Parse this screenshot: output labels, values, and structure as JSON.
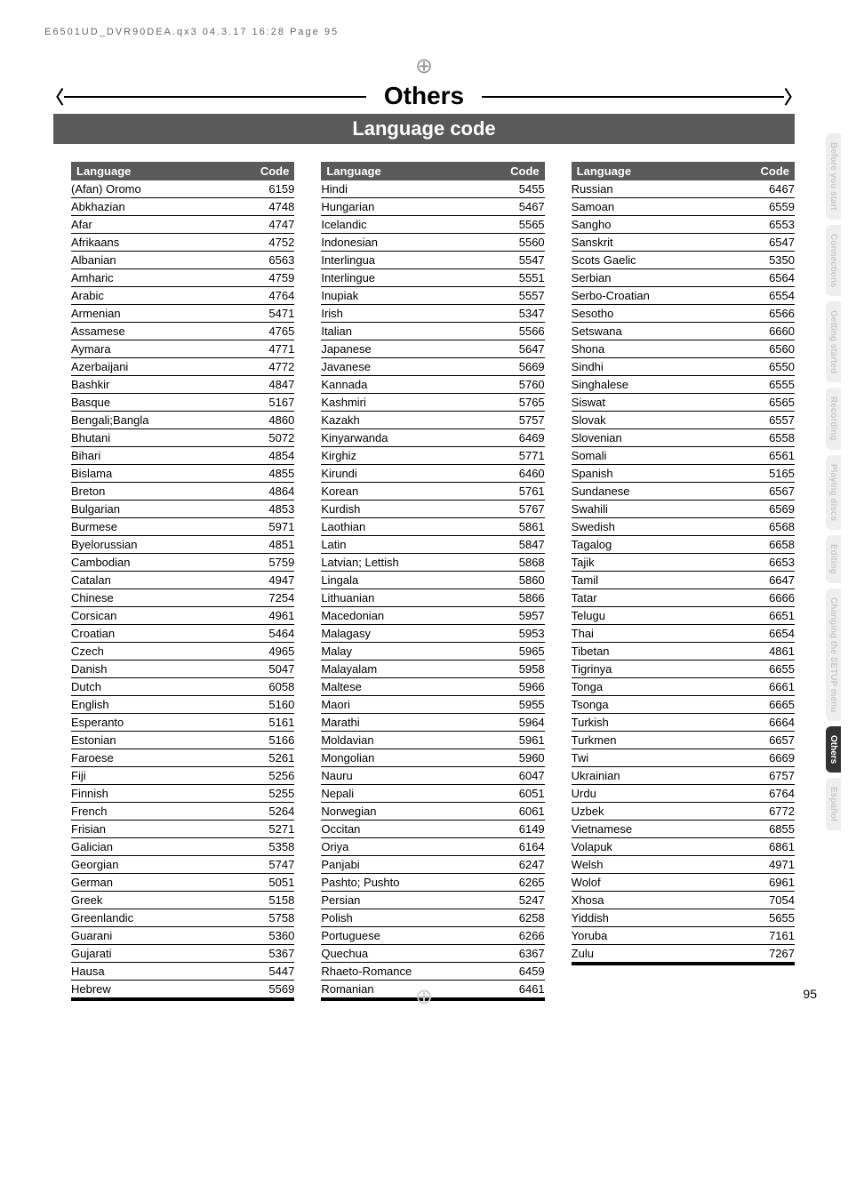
{
  "hdr": "E6501UD_DVR90DEA.qx3  04.3.17  16:28  Page 95",
  "title": "Others",
  "subtitle": "Language code",
  "th": {
    "lang": "Language",
    "code": "Code"
  },
  "tabs": [
    "Before you start",
    "Connections",
    "Getting started",
    "Recording",
    "Playing discs",
    "Editing",
    "Changing the SETUP menu",
    "Others",
    "Español"
  ],
  "tabActive": 7,
  "pageNum": "95",
  "col1": [
    [
      "(Afan) Oromo",
      "6159"
    ],
    [
      "Abkhazian",
      "4748"
    ],
    [
      "Afar",
      "4747"
    ],
    [
      "Afrikaans",
      "4752"
    ],
    [
      "Albanian",
      "6563"
    ],
    [
      "Amharic",
      "4759"
    ],
    [
      "Arabic",
      "4764"
    ],
    [
      "Armenian",
      "5471"
    ],
    [
      "Assamese",
      "4765"
    ],
    [
      "Aymara",
      "4771"
    ],
    [
      "Azerbaijani",
      "4772"
    ],
    [
      "Bashkir",
      "4847"
    ],
    [
      "Basque",
      "5167"
    ],
    [
      "Bengali;Bangla",
      "4860"
    ],
    [
      "Bhutani",
      "5072"
    ],
    [
      "Bihari",
      "4854"
    ],
    [
      "Bislama",
      "4855"
    ],
    [
      "Breton",
      "4864"
    ],
    [
      "Bulgarian",
      "4853"
    ],
    [
      "Burmese",
      "5971"
    ],
    [
      "Byelorussian",
      "4851"
    ],
    [
      "Cambodian",
      "5759"
    ],
    [
      "Catalan",
      "4947"
    ],
    [
      "Chinese",
      "7254"
    ],
    [
      "Corsican",
      "4961"
    ],
    [
      "Croatian",
      "5464"
    ],
    [
      "Czech",
      "4965"
    ],
    [
      "Danish",
      "5047"
    ],
    [
      "Dutch",
      "6058"
    ],
    [
      "English",
      "5160"
    ],
    [
      "Esperanto",
      "5161"
    ],
    [
      "Estonian",
      "5166"
    ],
    [
      "Faroese",
      "5261"
    ],
    [
      "Fiji",
      "5256"
    ],
    [
      "Finnish",
      "5255"
    ],
    [
      "French",
      "5264"
    ],
    [
      "Frisian",
      "5271"
    ],
    [
      "Galician",
      "5358"
    ],
    [
      "Georgian",
      "5747"
    ],
    [
      "German",
      "5051"
    ],
    [
      "Greek",
      "5158"
    ],
    [
      "Greenlandic",
      "5758"
    ],
    [
      "Guarani",
      "5360"
    ],
    [
      "Gujarati",
      "5367"
    ],
    [
      "Hausa",
      "5447"
    ],
    [
      "Hebrew",
      "5569"
    ]
  ],
  "col2": [
    [
      "Hindi",
      "5455"
    ],
    [
      "Hungarian",
      "5467"
    ],
    [
      "Icelandic",
      "5565"
    ],
    [
      "Indonesian",
      "5560"
    ],
    [
      "Interlingua",
      "5547"
    ],
    [
      "Interlingue",
      "5551"
    ],
    [
      "Inupiak",
      "5557"
    ],
    [
      "Irish",
      "5347"
    ],
    [
      "Italian",
      "5566"
    ],
    [
      "Japanese",
      "5647"
    ],
    [
      "Javanese",
      "5669"
    ],
    [
      "Kannada",
      "5760"
    ],
    [
      "Kashmiri",
      "5765"
    ],
    [
      "Kazakh",
      "5757"
    ],
    [
      "Kinyarwanda",
      "6469"
    ],
    [
      "Kirghiz",
      "5771"
    ],
    [
      "Kirundi",
      "6460"
    ],
    [
      "Korean",
      "5761"
    ],
    [
      "Kurdish",
      "5767"
    ],
    [
      "Laothian",
      "5861"
    ],
    [
      "Latin",
      "5847"
    ],
    [
      "Latvian; Lettish",
      "5868"
    ],
    [
      "Lingala",
      "5860"
    ],
    [
      "Lithuanian",
      "5866"
    ],
    [
      "Macedonian",
      "5957"
    ],
    [
      "Malagasy",
      "5953"
    ],
    [
      "Malay",
      "5965"
    ],
    [
      "Malayalam",
      "5958"
    ],
    [
      "Maltese",
      "5966"
    ],
    [
      "Maori",
      "5955"
    ],
    [
      "Marathi",
      "5964"
    ],
    [
      "Moldavian",
      "5961"
    ],
    [
      "Mongolian",
      "5960"
    ],
    [
      "Nauru",
      "6047"
    ],
    [
      "Nepali",
      "6051"
    ],
    [
      "Norwegian",
      "6061"
    ],
    [
      "Occitan",
      "6149"
    ],
    [
      "Oriya",
      "6164"
    ],
    [
      "Panjabi",
      "6247"
    ],
    [
      "Pashto; Pushto",
      "6265"
    ],
    [
      "Persian",
      "5247"
    ],
    [
      "Polish",
      "6258"
    ],
    [
      "Portuguese",
      "6266"
    ],
    [
      "Quechua",
      "6367"
    ],
    [
      "Rhaeto-Romance",
      "6459"
    ],
    [
      "Romanian",
      "6461"
    ]
  ],
  "col3": [
    [
      "Russian",
      "6467"
    ],
    [
      "Samoan",
      "6559"
    ],
    [
      "Sangho",
      "6553"
    ],
    [
      "Sanskrit",
      "6547"
    ],
    [
      "Scots Gaelic",
      "5350"
    ],
    [
      "Serbian",
      "6564"
    ],
    [
      "Serbo-Croatian",
      "6554"
    ],
    [
      "Sesotho",
      "6566"
    ],
    [
      "Setswana",
      "6660"
    ],
    [
      "Shona",
      "6560"
    ],
    [
      "Sindhi",
      "6550"
    ],
    [
      "Singhalese",
      "6555"
    ],
    [
      "Siswat",
      "6565"
    ],
    [
      "Slovak",
      "6557"
    ],
    [
      "Slovenian",
      "6558"
    ],
    [
      "Somali",
      "6561"
    ],
    [
      "Spanish",
      "5165"
    ],
    [
      "Sundanese",
      "6567"
    ],
    [
      "Swahili",
      "6569"
    ],
    [
      "Swedish",
      "6568"
    ],
    [
      "Tagalog",
      "6658"
    ],
    [
      "Tajik",
      "6653"
    ],
    [
      "Tamil",
      "6647"
    ],
    [
      "Tatar",
      "6666"
    ],
    [
      "Telugu",
      "6651"
    ],
    [
      "Thai",
      "6654"
    ],
    [
      "Tibetan",
      "4861"
    ],
    [
      "Tigrinya",
      "6655"
    ],
    [
      "Tonga",
      "6661"
    ],
    [
      "Tsonga",
      "6665"
    ],
    [
      "Turkish",
      "6664"
    ],
    [
      "Turkmen",
      "6657"
    ],
    [
      "Twi",
      "6669"
    ],
    [
      "Ukrainian",
      "6757"
    ],
    [
      "Urdu",
      "6764"
    ],
    [
      "Uzbek",
      "6772"
    ],
    [
      "Vietnamese",
      "6855"
    ],
    [
      "Volapuk",
      "6861"
    ],
    [
      "Welsh",
      "4971"
    ],
    [
      "Wolof",
      "6961"
    ],
    [
      "Xhosa",
      "7054"
    ],
    [
      "Yiddish",
      "5655"
    ],
    [
      "Yoruba",
      "7161"
    ],
    [
      "Zulu",
      "7267"
    ]
  ]
}
